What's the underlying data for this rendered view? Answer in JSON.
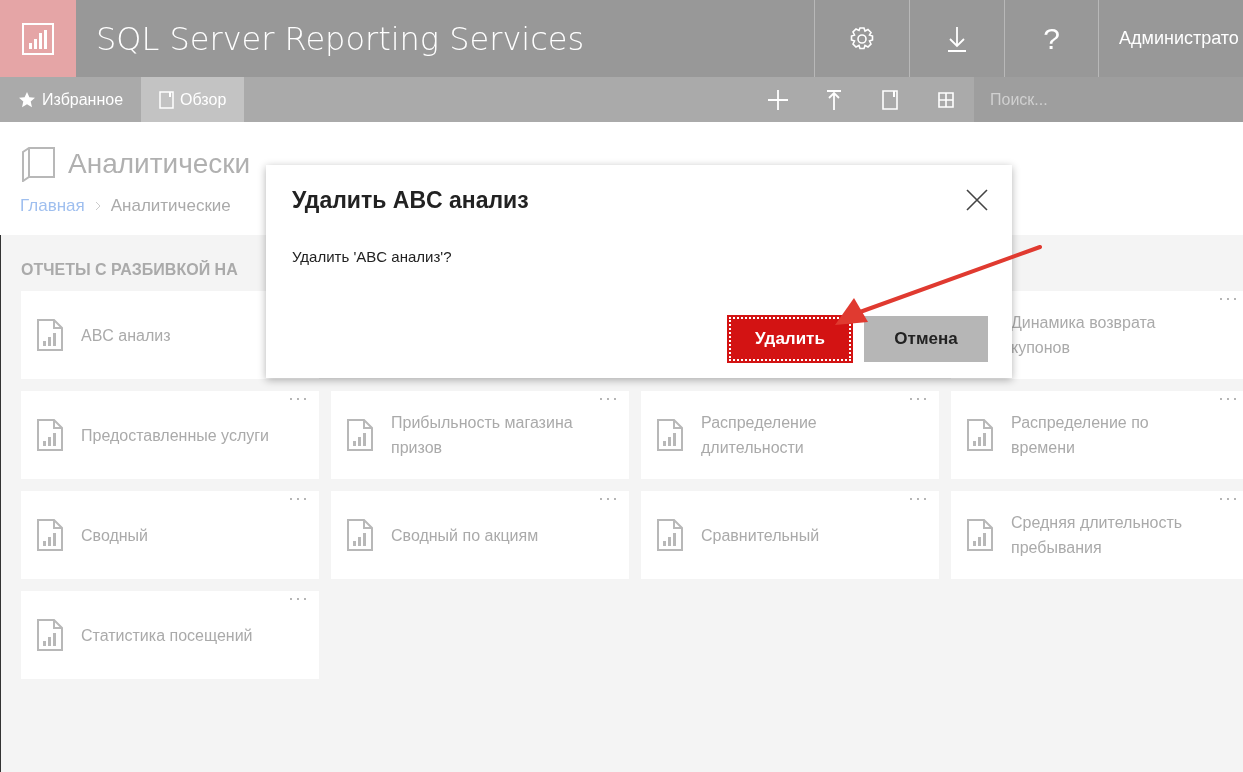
{
  "header": {
    "title": "SQL Server Reporting Services",
    "help": "?",
    "user": "Администрато"
  },
  "toolbar": {
    "tabs": [
      {
        "label": "Избранное",
        "selected": false
      },
      {
        "label": "Обзор",
        "selected": true
      }
    ],
    "search": {
      "placeholder": "Поиск..."
    }
  },
  "page": {
    "title": "Аналитически",
    "breadcrumb": [
      "Главная",
      "Аналитические"
    ],
    "section": "ОТЧЕТЫ С РАЗБИВКОЙ НА"
  },
  "tiles": [
    {
      "kind": "report",
      "name": "ABC анализ"
    },
    {
      "name": "Динамика возврата купонов",
      "menu": "···"
    },
    {
      "kind": "report",
      "name": "Предоставленные услуги",
      "menu": "···"
    },
    {
      "kind": "report",
      "name": "Прибыльность магазина призов",
      "menu": "···"
    },
    {
      "kind": "report",
      "name": "Распределение длительности",
      "menu": "···"
    },
    {
      "kind": "report",
      "name": "Распределение по времени",
      "menu": "···"
    },
    {
      "kind": "report",
      "name": "Сводный",
      "menu": "···"
    },
    {
      "kind": "report",
      "name": "Сводный по акциям",
      "menu": "···"
    },
    {
      "kind": "report",
      "name": "Сравнительный",
      "menu": "···"
    },
    {
      "kind": "report",
      "name": "Средняя длительность пребывания",
      "menu": "···"
    },
    {
      "kind": "report",
      "name": "Статистика посещений",
      "menu": "···"
    }
  ],
  "dialog": {
    "title": "Удалить ABC анализ",
    "message": "Удалить 'ABC анализ'?",
    "buttons": [
      {
        "label": "Удалить",
        "kind": "primary",
        "focused": true
      },
      {
        "label": "Отмена",
        "kind": "secondary",
        "focused": false
      }
    ]
  }
}
